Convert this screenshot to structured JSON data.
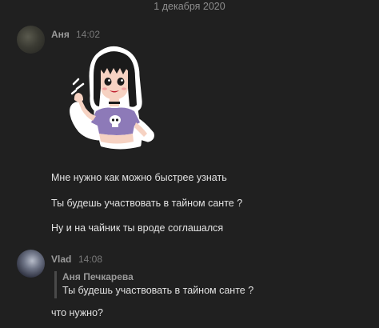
{
  "date_separator": "1 декабря 2020",
  "messages": [
    {
      "author": "Аня",
      "time": "14:02",
      "sticker": "girl-waving-sticker",
      "lines": [
        "Мне нужно как можно быстрее узнать",
        "Ты будешь участвовать в тайном санте ?",
        "Ну и на чайник ты вроде соглашался"
      ]
    },
    {
      "author": "Vlad",
      "time": "14:08",
      "quote": {
        "author": "Аня Печкарева",
        "text": "Ты будешь участвовать в тайном санте ?"
      },
      "lines": [
        "что нужно?"
      ]
    }
  ]
}
